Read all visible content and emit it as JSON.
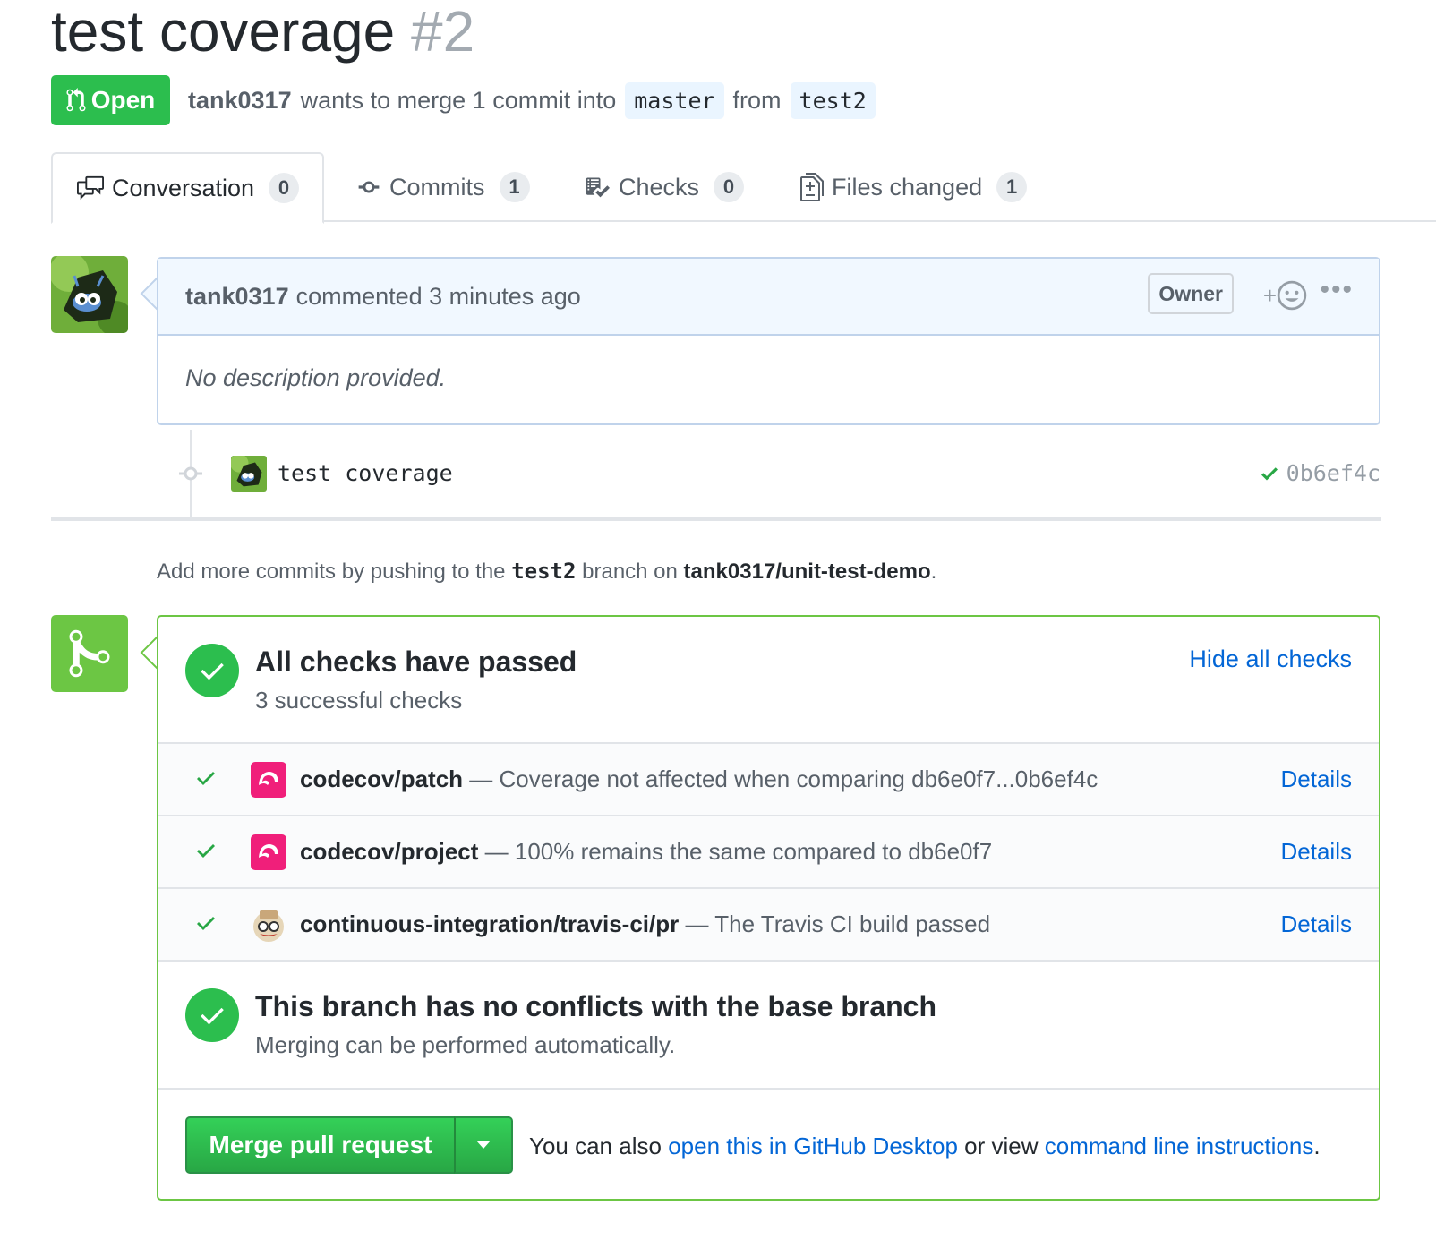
{
  "pr": {
    "title": "test coverage",
    "number": "#2",
    "state": "Open",
    "author": "tank0317",
    "merge_text": "wants to merge 1 commit into",
    "base_branch": "master",
    "from_text": "from",
    "head_branch": "test2"
  },
  "tabs": [
    {
      "label": "Conversation",
      "count": "0",
      "icon": "comment-discussion-icon"
    },
    {
      "label": "Commits",
      "count": "1",
      "icon": "git-commit-icon"
    },
    {
      "label": "Checks",
      "count": "0",
      "icon": "checklist-icon"
    },
    {
      "label": "Files changed",
      "count": "1",
      "icon": "diff-icon"
    }
  ],
  "comment": {
    "author": "tank0317",
    "action": "commented 3 minutes ago",
    "badge": "Owner",
    "reaction_plus": "+",
    "body": "No description provided."
  },
  "commit": {
    "message": "test coverage",
    "sha": "0b6ef4c"
  },
  "push_hint": {
    "prefix": "Add more commits by pushing to the",
    "branch": "test2",
    "middle": "branch on",
    "repo": "tank0317/unit-test-demo",
    "suffix": "."
  },
  "checks": {
    "title": "All checks have passed",
    "subtitle": "3 successful checks",
    "hide_label": "Hide all checks",
    "items": [
      {
        "name": "codecov/patch",
        "description": "— Coverage not affected when comparing db6e0f7...0b6ef4c",
        "details": "Details",
        "icon": "codecov-icon"
      },
      {
        "name": "codecov/project",
        "description": "— 100% remains the same compared to db6e0f7",
        "details": "Details",
        "icon": "codecov-icon"
      },
      {
        "name": "continuous-integration/travis-ci/pr",
        "description": "— The Travis CI build passed",
        "details": "Details",
        "icon": "travis-icon"
      }
    ]
  },
  "conflicts": {
    "title": "This branch has no conflicts with the base branch",
    "subtitle": "Merging can be performed automatically."
  },
  "merge": {
    "button_label": "Merge pull request",
    "note_prefix": "You can also",
    "desktop_link": "open this in GitHub Desktop",
    "note_middle": "or view",
    "cli_link": "command line instructions",
    "note_suffix": "."
  },
  "colors": {
    "success": "#2cbe4e",
    "link": "#0366d6",
    "merge_icon_bg": "#6cc644",
    "comment_header_bg": "#f1f8ff"
  }
}
